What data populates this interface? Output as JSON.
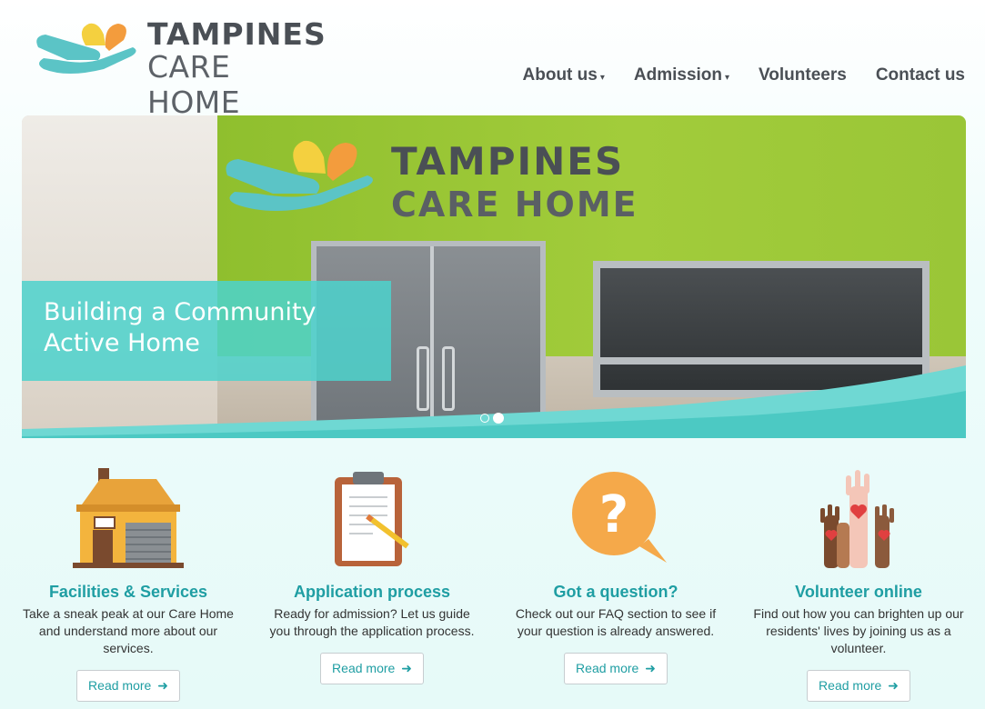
{
  "header": {
    "logo_top": "TAMPINES",
    "logo_bottom": "CARE HOME",
    "nav": [
      {
        "label": "About us",
        "dropdown": true
      },
      {
        "label": "Admission",
        "dropdown": true
      },
      {
        "label": "Volunteers",
        "dropdown": false
      },
      {
        "label": "Contact us",
        "dropdown": false
      }
    ]
  },
  "hero": {
    "sign_top": "TAMPINES",
    "sign_bottom": "CARE HOME",
    "caption_line1": "Building a Community",
    "caption_line2": "Active Home",
    "slides": 2,
    "active_slide": 2
  },
  "features": [
    {
      "icon": "house-icon",
      "title": "Facilities & Services",
      "desc": "Take a sneak peak at our Care Home and understand more about our services.",
      "button": "Read more"
    },
    {
      "icon": "clipboard-icon",
      "title": "Application process",
      "desc": "Ready for admission? Let us guide you through the application process.",
      "button": "Read more"
    },
    {
      "icon": "question-bubble-icon",
      "title": "Got a question?",
      "desc": "Check out our FAQ section to see if your question is already answered.",
      "button": "Read more"
    },
    {
      "icon": "raised-hands-icon",
      "title": "Volunteer online",
      "desc": "Find out how you can brighten up our residents' lives by joining us as a volunteer.",
      "button": "Read more"
    }
  ],
  "colors": {
    "accent": "#1f9ea3",
    "caption_bg": "#4cd2cd",
    "wall_green": "#9ac637",
    "text_dark": "#4a4f55"
  }
}
